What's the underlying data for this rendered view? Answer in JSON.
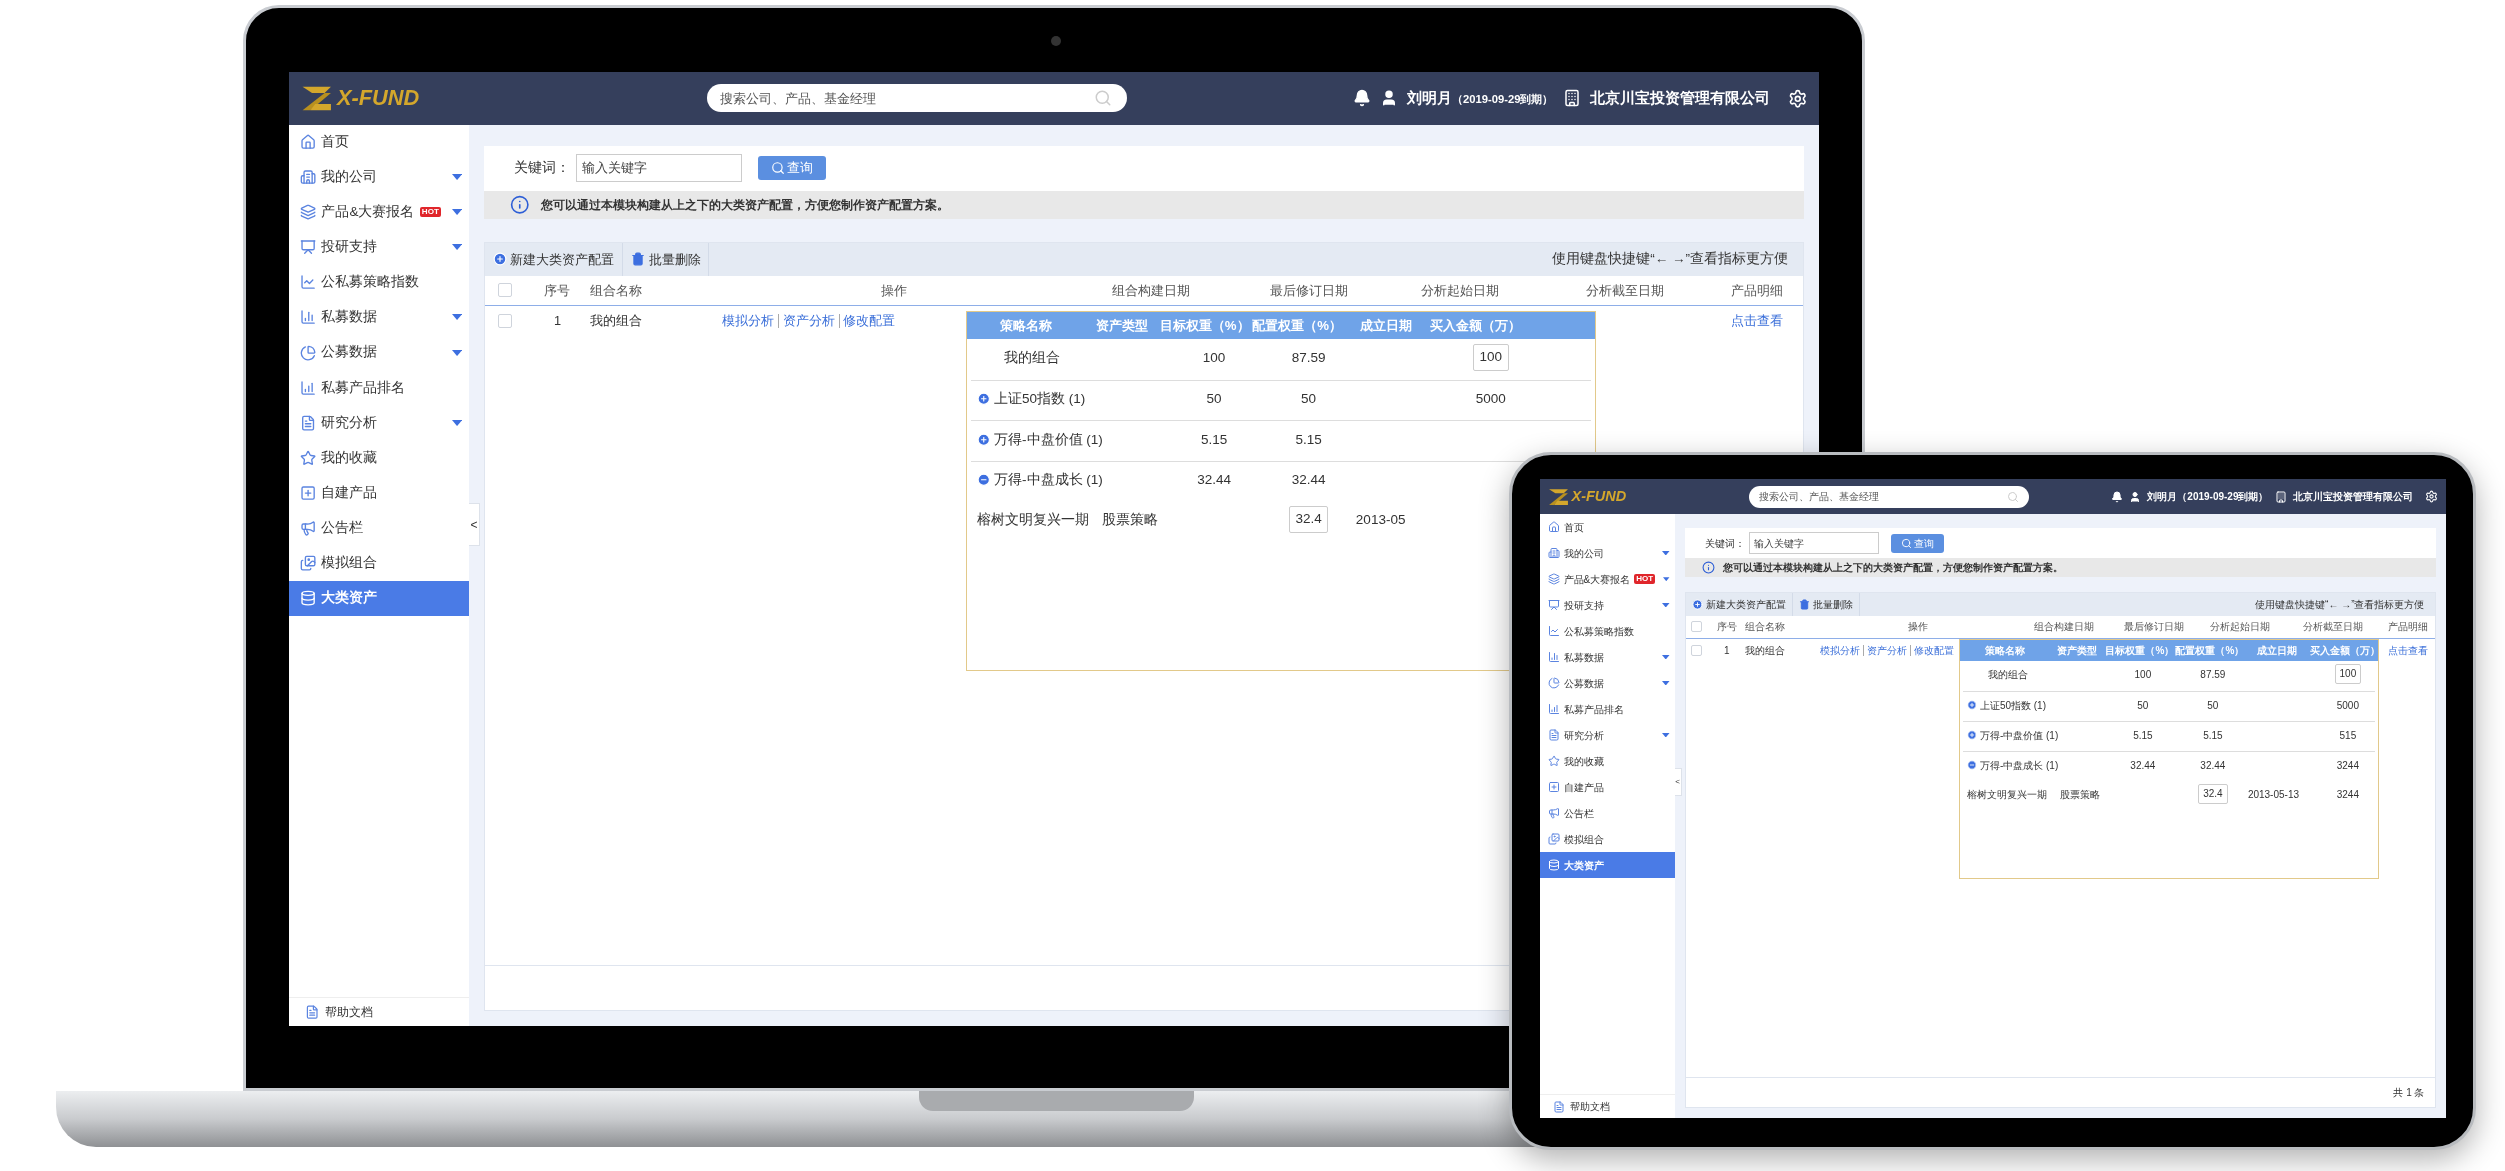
{
  "devices": [
    {
      "kind": "laptop",
      "screen": {
        "logo": "X-FUND",
        "search": {
          "placeholder": "搜索公司、产品、基金经理"
        },
        "user": {
          "name": "刘明月",
          "expiry": "（2019-09-29到期）"
        },
        "company": "北京川宝投资管理有限公司",
        "sidebar": {
          "items": [
            {
              "label": "首页",
              "selected": false,
              "has_submenu": false
            },
            {
              "label": "我的公司",
              "selected": false,
              "has_submenu": true
            },
            {
              "label": "产品&大赛报名",
              "selected": false,
              "has_submenu": true,
              "badge": "HOT"
            },
            {
              "label": "投研支持",
              "selected": false,
              "has_submenu": true
            },
            {
              "label": "公私募策略指数",
              "selected": false,
              "has_submenu": false
            },
            {
              "label": "私募数据",
              "selected": false,
              "has_submenu": true
            },
            {
              "label": "公募数据",
              "selected": false,
              "has_submenu": true
            },
            {
              "label": "私募产品排名",
              "selected": false,
              "has_submenu": false
            },
            {
              "label": "研究分析",
              "selected": false,
              "has_submenu": true
            },
            {
              "label": "我的收藏",
              "selected": false,
              "has_submenu": false
            },
            {
              "label": "自建产品",
              "selected": false,
              "has_submenu": false
            },
            {
              "label": "公告栏",
              "selected": false,
              "has_submenu": false
            },
            {
              "label": "模拟组合",
              "selected": false,
              "has_submenu": false
            },
            {
              "label": "大类资产",
              "selected": true,
              "has_submenu": false
            }
          ],
          "footer": "帮助文档"
        },
        "collapse": "<",
        "filter": {
          "label": "关键词：",
          "placeholder": "输入关键字",
          "button": "查询"
        },
        "notice": "您可以通过本模块构建从上之下的大类资产配置，方便您制作资产配置方案。",
        "toolbar": {
          "buttons": [
            "新建大类资产配置",
            "批量删除"
          ],
          "hint": "使用键盘快捷键“← →”查看指标更方便"
        },
        "table": {
          "all_checked": false,
          "columns": [
            "序号",
            "组合名称",
            "操作",
            "组合构建日期",
            "最后修订日期",
            "分析起始日期",
            "分析截至日期",
            "产品明细"
          ],
          "rows": [
            {
              "checked": false,
              "index": "1",
              "name": "我的组合",
              "actions": [
                "模拟分析",
                "资产分析",
                "修改配置"
              ],
              "link": "点击查看"
            }
          ]
        },
        "popup": {
          "columns": [
            "策略名称",
            "资产类型",
            "目标权重（%）",
            "配置权重（%）",
            "成立日期",
            "买入金额（万）"
          ],
          "rows": [
            {
              "kind": "summary",
              "cells": [
                {
                  "kind": "text",
                  "text": "我的组合"
                },
                null,
                {
                  "kind": "text",
                  "text": "100"
                },
                {
                  "kind": "text",
                  "text": "87.59"
                },
                null,
                {
                  "kind": "input",
                  "text": "100"
                }
              ]
            },
            {
              "kind": "group",
              "expanded": false,
              "cells": [
                {
                  "kind": "text",
                  "text": "上证50指数 (1)"
                },
                null,
                {
                  "kind": "text",
                  "text": "50"
                },
                {
                  "kind": "text",
                  "text": "50"
                },
                null,
                {
                  "kind": "text",
                  "text": "5000"
                }
              ]
            },
            {
              "kind": "group",
              "expanded": false,
              "cells": [
                {
                  "kind": "text",
                  "text": "万得-中盘价值 (1)"
                },
                null,
                {
                  "kind": "text",
                  "text": "5.15"
                },
                {
                  "kind": "text",
                  "text": "5.15"
                },
                null,
                null
              ]
            },
            {
              "kind": "group",
              "expanded": true,
              "cells": [
                {
                  "kind": "text",
                  "text": "万得-中盘成长 (1)"
                },
                null,
                {
                  "kind": "text",
                  "text": "32.44"
                },
                {
                  "kind": "text",
                  "text": "32.44"
                },
                null,
                null
              ]
            },
            {
              "kind": "item",
              "cells": [
                {
                  "kind": "text",
                  "text": "榕树文明复兴一期"
                },
                {
                  "kind": "text",
                  "text": "股票策略"
                },
                null,
                {
                  "kind": "input",
                  "text": "32.4"
                },
                {
                  "kind": "text",
                  "text": "2013-05"
                },
                null
              ]
            }
          ]
        }
      }
    },
    {
      "kind": "tablet",
      "screen": {
        "logo": "X-FUND",
        "search": {
          "placeholder": "搜索公司、产品、基金经理"
        },
        "user": {
          "name": "刘明月",
          "expiry": "（2019-09-29到期）"
        },
        "company": "北京川宝投资管理有限公司",
        "sidebar": {
          "items": [
            {
              "label": "首页",
              "selected": false,
              "has_submenu": false
            },
            {
              "label": "我的公司",
              "selected": false,
              "has_submenu": true
            },
            {
              "label": "产品&大赛报名",
              "selected": false,
              "has_submenu": true,
              "badge": "HOT"
            },
            {
              "label": "投研支持",
              "selected": false,
              "has_submenu": true
            },
            {
              "label": "公私募策略指数",
              "selected": false,
              "has_submenu": false
            },
            {
              "label": "私募数据",
              "selected": false,
              "has_submenu": true
            },
            {
              "label": "公募数据",
              "selected": false,
              "has_submenu": true
            },
            {
              "label": "私募产品排名",
              "selected": false,
              "has_submenu": false
            },
            {
              "label": "研究分析",
              "selected": false,
              "has_submenu": true
            },
            {
              "label": "我的收藏",
              "selected": false,
              "has_submenu": false
            },
            {
              "label": "自建产品",
              "selected": false,
              "has_submenu": false
            },
            {
              "label": "公告栏",
              "selected": false,
              "has_submenu": false
            },
            {
              "label": "模拟组合",
              "selected": false,
              "has_submenu": false
            },
            {
              "label": "大类资产",
              "selected": true,
              "has_submenu": false
            }
          ],
          "footer": "帮助文档"
        },
        "collapse": "<",
        "filter": {
          "label": "关键词：",
          "placeholder": "输入关键字",
          "button": "查询"
        },
        "notice": "您可以通过本模块构建从上之下的大类资产配置，方便您制作资产配置方案。",
        "toolbar": {
          "buttons": [
            "新建大类资产配置",
            "批量删除"
          ],
          "hint": "使用键盘快捷键“← →”查看指标更方便"
        },
        "table": {
          "all_checked": false,
          "columns": [
            "序号",
            "组合名称",
            "操作",
            "组合构建日期",
            "最后修订日期",
            "分析起始日期",
            "分析截至日期",
            "产品明细"
          ],
          "rows": [
            {
              "checked": false,
              "index": "1",
              "name": "我的组合",
              "actions": [
                "模拟分析",
                "资产分析",
                "修改配置"
              ],
              "link": "点击查看"
            }
          ]
        },
        "popup": {
          "columns": [
            "策略名称",
            "资产类型",
            "目标权重（%）",
            "配置权重（%）",
            "成立日期",
            "买入金额（万）"
          ],
          "rows": [
            {
              "kind": "summary",
              "cells": [
                {
                  "kind": "text",
                  "text": "我的组合"
                },
                null,
                {
                  "kind": "text",
                  "text": "100"
                },
                {
                  "kind": "text",
                  "text": "87.59"
                },
                null,
                {
                  "kind": "input",
                  "text": "100"
                }
              ]
            },
            {
              "kind": "group",
              "expanded": false,
              "cells": [
                {
                  "kind": "text",
                  "text": "上证50指数 (1)"
                },
                null,
                {
                  "kind": "text",
                  "text": "50"
                },
                {
                  "kind": "text",
                  "text": "50"
                },
                null,
                {
                  "kind": "text",
                  "text": "5000"
                }
              ]
            },
            {
              "kind": "group",
              "expanded": false,
              "cells": [
                {
                  "kind": "text",
                  "text": "万得-中盘价值 (1)"
                },
                null,
                {
                  "kind": "text",
                  "text": "5.15"
                },
                {
                  "kind": "text",
                  "text": "5.15"
                },
                null,
                {
                  "kind": "text",
                  "text": "515"
                }
              ]
            },
            {
              "kind": "group",
              "expanded": true,
              "cells": [
                {
                  "kind": "text",
                  "text": "万得-中盘成长 (1)"
                },
                null,
                {
                  "kind": "text",
                  "text": "32.44"
                },
                {
                  "kind": "text",
                  "text": "32.44"
                },
                null,
                {
                  "kind": "text",
                  "text": "3244"
                }
              ]
            },
            {
              "kind": "item",
              "cells": [
                {
                  "kind": "text",
                  "text": "榕树文明复兴一期"
                },
                {
                  "kind": "text",
                  "text": "股票策略"
                },
                null,
                {
                  "kind": "input",
                  "text": "32.4"
                },
                {
                  "kind": "text",
                  "text": "2013-05-13"
                },
                {
                  "kind": "text",
                  "text": "3244"
                }
              ]
            }
          ]
        },
        "record_count": "共 1 条"
      }
    }
  ]
}
